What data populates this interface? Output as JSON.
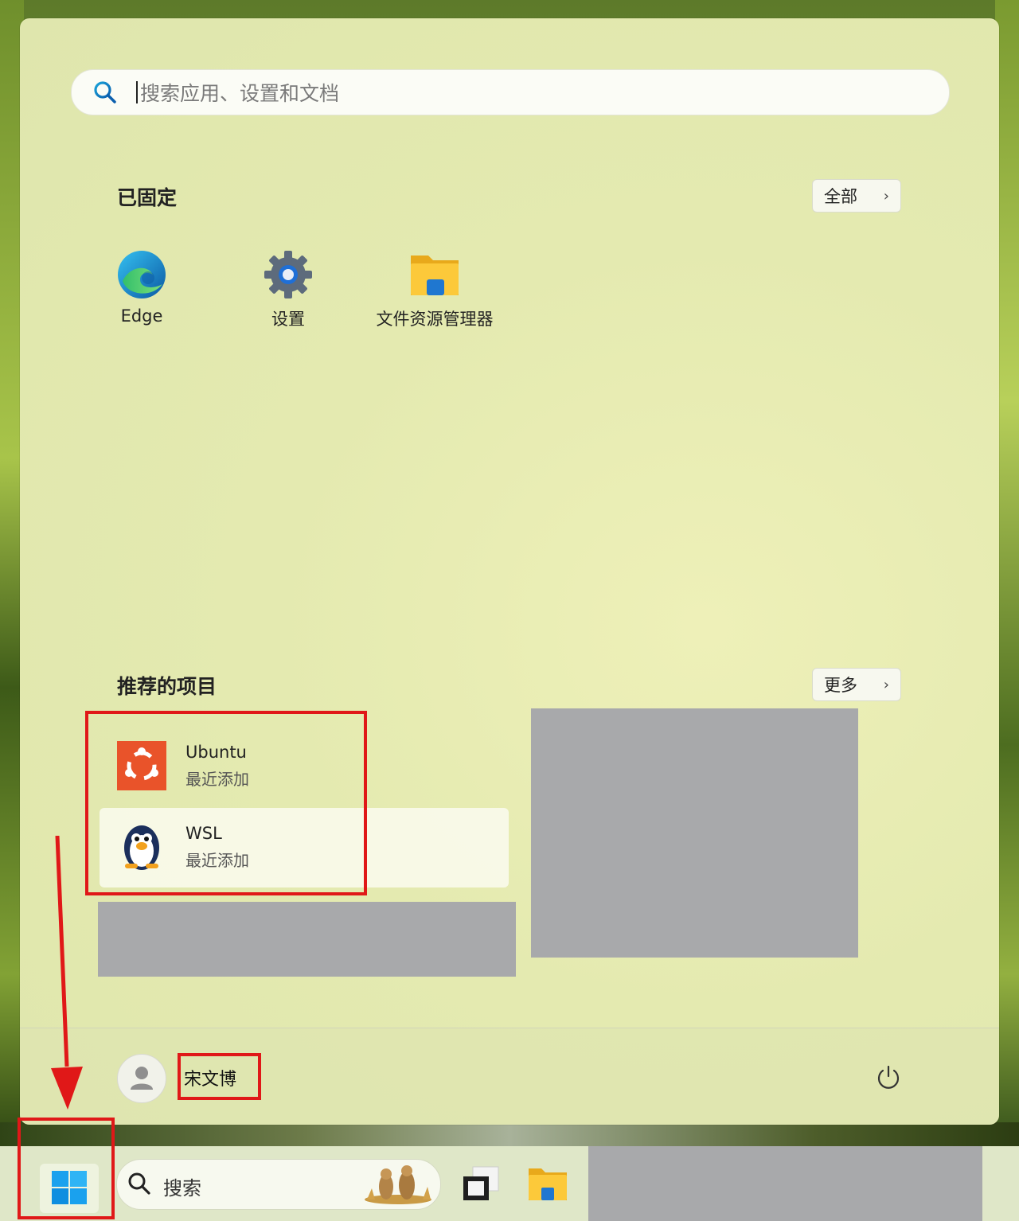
{
  "search": {
    "placeholder": "搜索应用、设置和文档"
  },
  "pinned": {
    "title": "已固定",
    "all_button": "全部",
    "apps": [
      {
        "label": "Edge",
        "icon": "edge-icon"
      },
      {
        "label": "设置",
        "icon": "settings-gear-icon"
      },
      {
        "label": "文件资源管理器",
        "icon": "file-explorer-icon"
      }
    ]
  },
  "recommended": {
    "title": "推荐的项目",
    "more_button": "更多",
    "items": [
      {
        "name": "Ubuntu",
        "subtitle": "最近添加",
        "icon": "ubuntu-icon"
      },
      {
        "name": "WSL",
        "subtitle": "最近添加",
        "icon": "wsl-penguin-icon"
      }
    ]
  },
  "user": {
    "name": "宋文博"
  },
  "taskbar": {
    "search_label": "搜索"
  },
  "colors": {
    "highlight": "#e01818",
    "redaction": "#a8a9ab",
    "accent": "#0078d4"
  }
}
